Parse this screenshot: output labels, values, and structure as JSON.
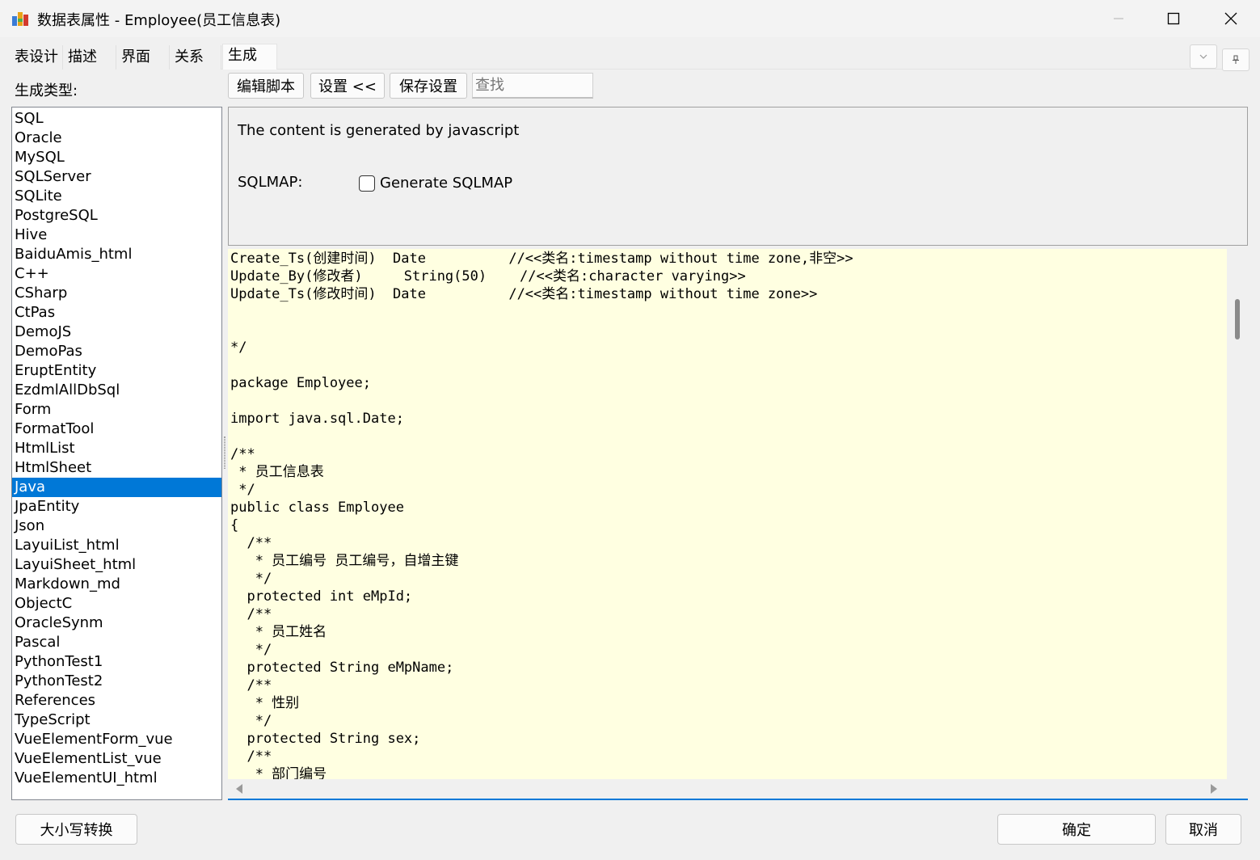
{
  "window": {
    "title": "数据表属性 - Employee(员工信息表)"
  },
  "tabs": [
    {
      "label": "表设计"
    },
    {
      "label": "描述"
    },
    {
      "label": "界面"
    },
    {
      "label": "关系"
    },
    {
      "label": "生成",
      "active": true
    }
  ],
  "left_panel": {
    "label": "生成类型:",
    "items": [
      "SQL",
      "Oracle",
      "MySQL",
      "SQLServer",
      "SQLite",
      "PostgreSQL",
      "Hive",
      "BaiduAmis_html",
      "C++",
      "CSharp",
      "CtPas",
      "DemoJS",
      "DemoPas",
      "EruptEntity",
      "EzdmlAllDbSql",
      "Form",
      "FormatTool",
      "HtmlList",
      "HtmlSheet",
      "Java",
      "JpaEntity",
      "Json",
      "LayuiList_html",
      "LayuiSheet_html",
      "Markdown_md",
      "ObjectC",
      "OracleSynm",
      "Pascal",
      "PythonTest1",
      "PythonTest2",
      "References",
      "TypeScript",
      "VueElementForm_vue",
      "VueElementList_vue",
      "VueElementUI_html"
    ],
    "selected": "Java"
  },
  "toolbar": {
    "edit_script": "编辑脚本",
    "settings": "设置 <<",
    "save_settings": "保存设置",
    "search_placeholder": "查找"
  },
  "settings_panel": {
    "description": "The content is generated by javascript",
    "sqlmap_label": "SQLMAP:",
    "generate_sqlmap_label": "Generate SQLMAP",
    "generate_sqlmap_checked": false
  },
  "code_lines": [
    "Create_Ts(创建时间)  Date          //<<类名:timestamp without time zone,非空>>",
    "Update_By(修改者)     String(50)    //<<类名:character varying>>",
    "Update_Ts(修改时间)  Date          //<<类名:timestamp without time zone>>",
    "",
    "",
    "*/",
    "",
    "package Employee;",
    "",
    "import java.sql.Date;",
    "",
    "/**",
    " * 员工信息表",
    " */",
    "public class Employee",
    "{",
    "  /**",
    "   * 员工编号 员工编号，自增主键",
    "   */",
    "  protected int eMpId;",
    "  /**",
    "   * 员工姓名",
    "   */",
    "  protected String eMpName;",
    "  /**",
    "   * 性别",
    "   */",
    "  protected String sex;",
    "  /**",
    "   * 部门编号"
  ],
  "bottom": {
    "case_convert": "大小写转换",
    "ok": "确定",
    "cancel": "取消"
  },
  "colors": {
    "selection": "#0078d7",
    "code_background": "#ffffe1"
  }
}
